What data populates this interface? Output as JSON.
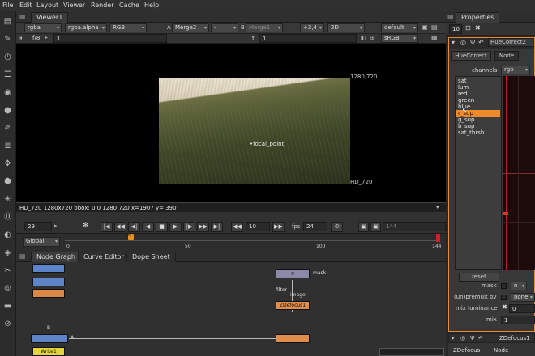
{
  "menu": [
    "File",
    "Edit",
    "Layout",
    "Viewer",
    "Render",
    "Cache",
    "Help"
  ],
  "viewer": {
    "tab": "Viewer1",
    "ctl1": {
      "channels": "rgba",
      "alpha": "rgba.alpha",
      "colorspace": "RGB",
      "a_label": "A",
      "a_input": "Merge2",
      "mode": "-",
      "b_label": "B",
      "b_input": "Merge1",
      "gain": "+3,4",
      "view": "2D",
      "lut": "default"
    },
    "ctl2": {
      "fstop": "f/8",
      "gain_value": "1",
      "gamma_label": "Y",
      "gamma_value": "1",
      "lut2": "sRGB"
    },
    "format_top_right": "1280,720",
    "format_bottom_right": "HD_720",
    "focal_label": "focal_point",
    "info_bar": "HD_720 1280x720  bbox: 0 0 1280 720  x=1907 y= 390",
    "frame": "29",
    "fps_label": "fps",
    "fps_value": "24",
    "step_value": "10",
    "range_scope": "Global",
    "end_field": "144",
    "ticks": [
      "0",
      "50",
      "100",
      "144"
    ],
    "playhead": "29"
  },
  "node_graph": {
    "tabs": [
      "Node Graph",
      "Curve Editor",
      "Dope Sheet"
    ],
    "nodes": {
      "mask": "mask",
      "filter": "filter",
      "image": "image",
      "zdefocus": "ZDefocus1",
      "write": "Write1",
      "a_label": "A",
      "b_label": "B"
    }
  },
  "properties": {
    "tab": "Properties",
    "count": "10",
    "node_title": "HueCorrect2",
    "subtabs": [
      "HueCorrect",
      "Node"
    ],
    "channels_label": "channels",
    "channels_value": "rgb",
    "curves": [
      "sat",
      "lum",
      "red",
      "green",
      "blue",
      "r_sup",
      "g_sup",
      "b_sup",
      "sat_thrsh"
    ],
    "selected_curve": "r_sup",
    "reset_label": "reset",
    "mask_label": "mask",
    "mask_value": "n",
    "unpremult_label": "(un)premult by",
    "unpremult_value": "none",
    "mix_lum_label": "mix luminance",
    "mix_lum_value": "0",
    "mix_label": "mix",
    "mix_value": "1",
    "next_node": "ZDefocus1",
    "next_tabs": [
      "ZDefocus",
      "Node"
    ]
  }
}
